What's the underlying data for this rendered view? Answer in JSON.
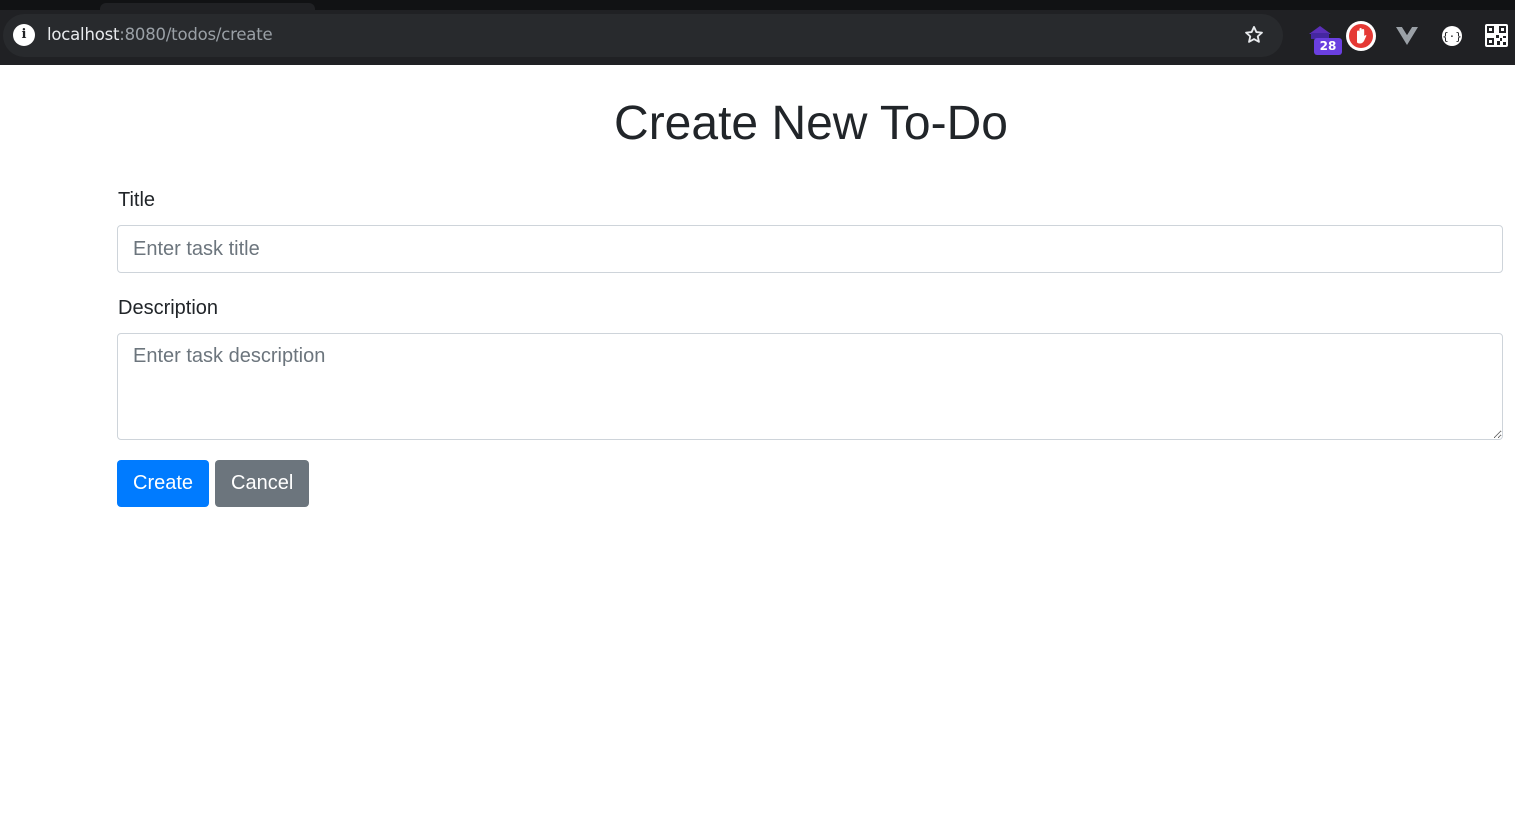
{
  "browser": {
    "url_host": "localhost",
    "url_rest": ":8080/todos/create",
    "icons": [
      "info-icon",
      "bookmark-star-icon",
      "stack-extension-icon",
      "adblock-hand-icon",
      "vue-devtools-icon",
      "json-viewer-icon",
      "qr-code-icon"
    ],
    "extension_badge": "28"
  },
  "page": {
    "heading": "Create New To-Do",
    "title_label": "Title",
    "title_placeholder": "Enter task title",
    "title_value": "",
    "description_label": "Description",
    "description_placeholder": "Enter task description",
    "description_value": "",
    "create_button": "Create",
    "cancel_button": "Cancel"
  },
  "colors": {
    "primary": "#007bff",
    "secondary": "#6c757d",
    "chrome_dark": "#202124",
    "badge": "#6a3fe0"
  }
}
